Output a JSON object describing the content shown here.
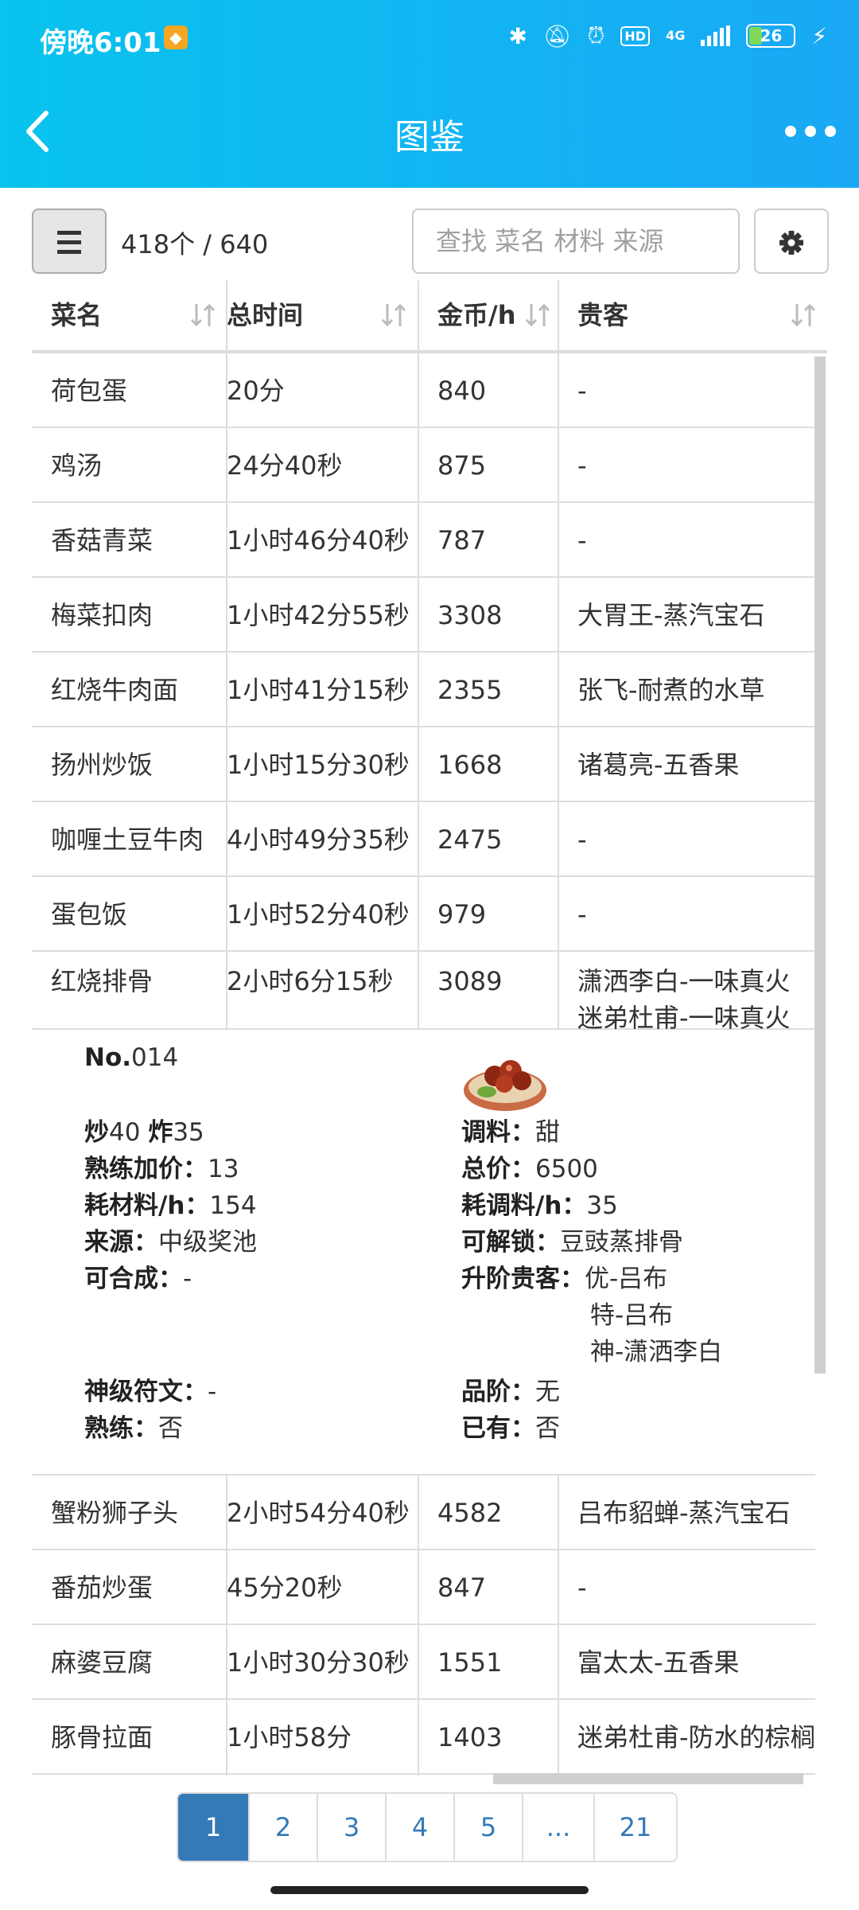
{
  "status_bar": {
    "time": "傍晚6:01",
    "network": "4G",
    "hd": "HD",
    "battery": "26"
  },
  "nav": {
    "title": "图鉴"
  },
  "toolbar": {
    "count": "418个 / 640",
    "search_placeholder": "查找 菜名 材料 来源"
  },
  "table": {
    "headers": [
      "菜名",
      "总时间",
      "金币/h",
      "贵客"
    ],
    "rows_top": [
      {
        "name": "荷包蛋",
        "time": "20分",
        "gold": "840",
        "guest": "-"
      },
      {
        "name": "鸡汤",
        "time": "24分40秒",
        "gold": "875",
        "guest": "-"
      },
      {
        "name": "香菇青菜",
        "time": "1小时46分40秒",
        "gold": "787",
        "guest": "-"
      },
      {
        "name": "梅菜扣肉",
        "time": "1小时42分55秒",
        "gold": "3308",
        "guest": "大胃王-蒸汽宝石"
      },
      {
        "name": "红烧牛肉面",
        "time": "1小时41分15秒",
        "gold": "2355",
        "guest": "张飞-耐煮的水草"
      },
      {
        "name": "扬州炒饭",
        "time": "1小时15分30秒",
        "gold": "1668",
        "guest": "诸葛亮-五香果"
      },
      {
        "name": "咖喱土豆牛肉",
        "time": "4小时49分35秒",
        "gold": "2475",
        "guest": "-"
      },
      {
        "name": "蛋包饭",
        "time": "1小时52分40秒",
        "gold": "979",
        "guest": "-"
      }
    ],
    "expanded_row": {
      "name": "红烧排骨",
      "time": "2小时6分15秒",
      "gold": "3089",
      "guest_1": "潇洒李白-一味真火",
      "guest_2": "迷弟杜甫-一味真火"
    },
    "detail": {
      "no_label": "No.",
      "no_value": "014",
      "skill_a_label": "炒",
      "skill_a_value": "40",
      "skill_b_label": "炸",
      "skill_b_value": "35",
      "seasoning_label": "调料：",
      "seasoning_value": "甜",
      "bonus_label": "熟练加价：",
      "bonus_value": "13",
      "total_label": "总价：",
      "total_value": "6500",
      "mat_label": "耗材料/h：",
      "mat_value": "154",
      "season_rate_label": "耗调料/h：",
      "season_rate_value": "35",
      "source_label": "来源：",
      "source_value": "中级奖池",
      "unlock_label": "可解锁：",
      "unlock_value": "豆豉蒸排骨",
      "combine_label": "可合成：",
      "combine_value": "-",
      "upgrade_label": "升阶贵客：",
      "upgrade_1": "优-吕布",
      "upgrade_2": "特-吕布",
      "upgrade_3": "神-潇洒李白",
      "rune_label": "神级符文：",
      "rune_value": "-",
      "grade_label": "品阶：",
      "grade_value": "无",
      "skilled_label": "熟练：",
      "skilled_value": "否",
      "owned_label": "已有：",
      "owned_value": "否"
    },
    "rows_bottom": [
      {
        "name": "蟹粉狮子头",
        "time": "2小时54分40秒",
        "gold": "4582",
        "guest": "吕布貂蝉-蒸汽宝石"
      },
      {
        "name": "番茄炒蛋",
        "time": "45分20秒",
        "gold": "847",
        "guest": "-"
      },
      {
        "name": "麻婆豆腐",
        "time": "1小时30分30秒",
        "gold": "1551",
        "guest": "富太太-五香果"
      },
      {
        "name": "豚骨拉面",
        "time": "1小时58分",
        "gold": "1403",
        "guest": "迷弟杜甫-防水的棕榈"
      }
    ]
  },
  "pagination": {
    "pages": [
      "1",
      "2",
      "3",
      "4",
      "5",
      "...",
      "21"
    ],
    "active": "1"
  },
  "colors": {
    "header_start": "#08c3ee",
    "header_end": "#1aa8f5",
    "pager_accent": "#337ab7"
  }
}
